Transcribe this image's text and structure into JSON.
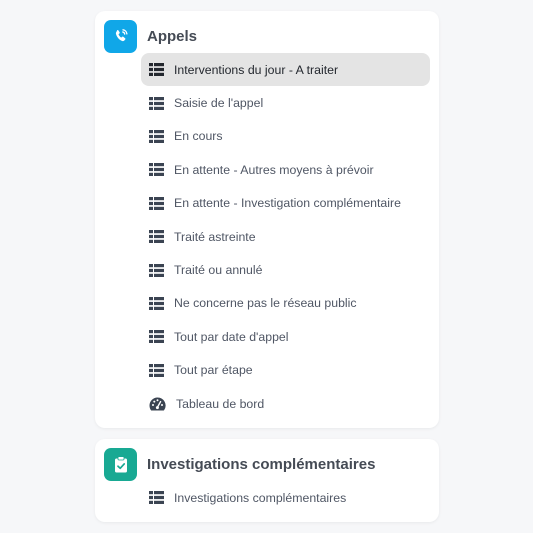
{
  "sections": [
    {
      "title": "Appels",
      "icon": "phone-icon",
      "color": "#10a7e8",
      "items": [
        {
          "label": "Interventions du jour - A traiter",
          "icon": "table-list-icon",
          "active": true
        },
        {
          "label": "Saisie de l'appel",
          "icon": "table-list-icon"
        },
        {
          "label": "En cours",
          "icon": "table-list-icon"
        },
        {
          "label": "En attente - Autres moyens à prévoir",
          "icon": "table-list-icon"
        },
        {
          "label": "En attente - Investigation complémentaire",
          "icon": "table-list-icon"
        },
        {
          "label": "Traité astreinte",
          "icon": "table-list-icon"
        },
        {
          "label": "Traité ou annulé",
          "icon": "table-list-icon"
        },
        {
          "label": "Ne concerne pas le réseau public",
          "icon": "table-list-icon"
        },
        {
          "label": "Tout par date d'appel",
          "icon": "table-list-icon"
        },
        {
          "label": "Tout par étape",
          "icon": "table-list-icon"
        },
        {
          "label": "Tableau de bord",
          "icon": "gauge-icon"
        }
      ]
    },
    {
      "title": "Investigations complémentaires",
      "icon": "clipboard-check-icon",
      "color": "#18a993",
      "items": [
        {
          "label": "Investigations complémentaires",
          "icon": "table-list-icon"
        }
      ]
    }
  ],
  "colors": {
    "active_item_bg": "#e4e4e4",
    "icon_dark": "#3b4452"
  }
}
